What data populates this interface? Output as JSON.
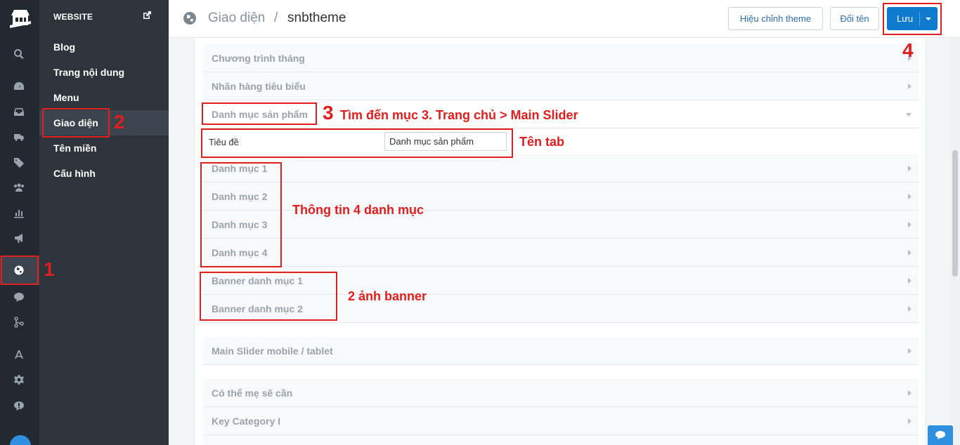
{
  "sidebar": {
    "icons": [
      "store-logo",
      "search-icon",
      "dashboard-icon",
      "inbox-icon",
      "truck-icon",
      "tag-icon",
      "users-icon",
      "chart-icon",
      "megaphone-icon",
      "globe-icon",
      "chat-icon",
      "share-icon",
      "apps-icon",
      "gear-icon",
      "alert-icon",
      "avatar"
    ]
  },
  "submenu": {
    "heading": "WEBSITE",
    "items": [
      {
        "label": "Blog"
      },
      {
        "label": "Trang nội dung"
      },
      {
        "label": "Menu"
      },
      {
        "label": "Giao diện",
        "active": true
      },
      {
        "label": "Tên miền"
      },
      {
        "label": "Cấu hình"
      }
    ]
  },
  "header": {
    "breadcrumb": "Giao diện",
    "separator": "/",
    "title": "snbtheme",
    "edit_theme_label": "Hiệu chỉnh theme",
    "rename_label": "Đổi tên",
    "save_label": "Lưu"
  },
  "sections": [
    {
      "label": "Chương trình tháng",
      "state": "collapsed"
    },
    {
      "label": "Nhãn hàng tiêu biểu",
      "state": "collapsed"
    },
    {
      "label": "Danh mục sản phẩm",
      "state": "expanded"
    },
    {
      "label": "Danh mục 1",
      "state": "collapsed"
    },
    {
      "label": "Danh mục 2",
      "state": "collapsed"
    },
    {
      "label": "Danh mục 3",
      "state": "collapsed"
    },
    {
      "label": "Danh mục 4",
      "state": "collapsed"
    },
    {
      "label": "Banner danh mục 1",
      "state": "collapsed"
    },
    {
      "label": "Banner danh mục 2",
      "state": "collapsed"
    },
    {
      "label": "Main Slider mobile / tablet",
      "state": "collapsed"
    },
    {
      "label": "Có thể mẹ sẽ cần",
      "state": "collapsed"
    },
    {
      "label": "Key Category I",
      "state": "collapsed"
    }
  ],
  "field": {
    "label": "Tiêu đề",
    "value": "Danh mục sản phẩm"
  },
  "annotations": {
    "n1": "1",
    "n2": "2",
    "n3": "3",
    "n4": "4",
    "step3_note": "Tìm đến mục 3. Trang chủ > Main Slider",
    "tab_name_note": "Tên tab",
    "categories_note": "Thông tin 4 danh mục",
    "banner_note": "2 ảnh banner"
  },
  "colors": {
    "rail": "#222931",
    "submenu": "#2e343b",
    "primary": "#0f7bcf",
    "annotation": "#e11d1d"
  }
}
